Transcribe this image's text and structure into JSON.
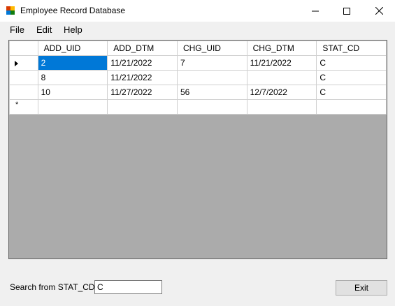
{
  "window": {
    "title": "Employee Record Database",
    "icon": "app-icon",
    "controls": [
      "minimize-icon",
      "maximize-icon",
      "close-icon"
    ]
  },
  "menu": {
    "items": [
      "File",
      "Edit",
      "Help"
    ]
  },
  "grid": {
    "columns": [
      "ADD_UID",
      "ADD_DTM",
      "CHG_UID",
      "CHG_DTM",
      "STAT_CD"
    ],
    "rows": [
      [
        "2",
        "11/21/2022",
        "7",
        "11/21/2022",
        "C"
      ],
      [
        "8",
        "11/21/2022",
        "",
        "",
        "C"
      ],
      [
        "10",
        "11/27/2022",
        "56",
        "12/7/2022",
        "C"
      ],
      [
        "",
        "",
        "",
        "",
        ""
      ]
    ],
    "current_row_indicator": "arrow",
    "new_row_indicator": "*",
    "selected_cell_color": "#0078d7"
  },
  "search": {
    "label": "Search from STAT_CD:",
    "value": "C"
  },
  "exit_button": {
    "label": "Exit"
  }
}
